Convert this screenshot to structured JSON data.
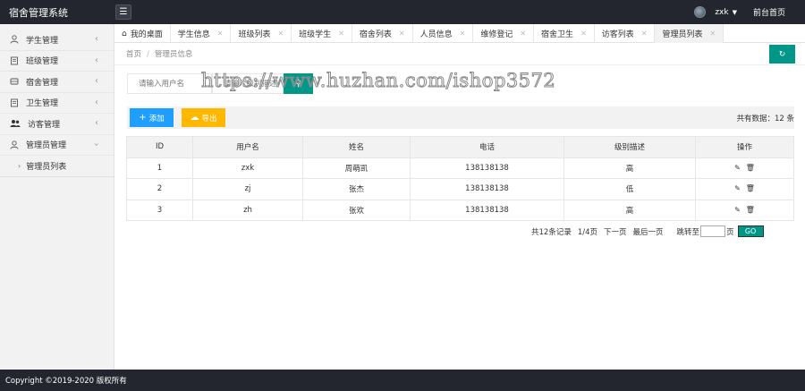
{
  "header": {
    "title": "宿舍管理系统",
    "menu_toggle_icon": "hamburger-icon",
    "user": "zxk",
    "front_link": "前台首页"
  },
  "sidebar": {
    "items": [
      {
        "label": "学生管理",
        "icon": "user-icon"
      },
      {
        "label": "班级管理",
        "icon": "file-icon"
      },
      {
        "label": "宿舍管理",
        "icon": "dorm-icon"
      },
      {
        "label": "卫生管理",
        "icon": "file-icon"
      },
      {
        "label": "访客管理",
        "icon": "users-icon"
      },
      {
        "label": "管理员管理",
        "icon": "admin-icon",
        "expanded": true
      }
    ],
    "sub_items": [
      {
        "label": "管理员列表"
      }
    ]
  },
  "tabs": [
    {
      "label": "我的桌面",
      "closable": false
    },
    {
      "label": "学生信息",
      "closable": true
    },
    {
      "label": "班级列表",
      "closable": true
    },
    {
      "label": "班级学生",
      "closable": true
    },
    {
      "label": "宿舍列表",
      "closable": true
    },
    {
      "label": "人员信息",
      "closable": true
    },
    {
      "label": "维修登记",
      "closable": true
    },
    {
      "label": "宿舍卫生",
      "closable": true
    },
    {
      "label": "访客列表",
      "closable": true
    },
    {
      "label": "管理员列表",
      "closable": true,
      "active": true
    }
  ],
  "breadcrumb": {
    "home": "首页",
    "current": "管理员信息"
  },
  "search": {
    "username_placeholder": "请输入用户名",
    "level_placeholder": "请输入级别描述"
  },
  "toolbar": {
    "add_label": "添加",
    "export_label": "导出",
    "total_label": "共有数据：",
    "total_value": "12 条"
  },
  "table": {
    "columns": [
      "ID",
      "用户名",
      "姓名",
      "电话",
      "级别描述",
      "操作"
    ],
    "rows": [
      {
        "id": "1",
        "username": "zxk",
        "name": "周萌凯",
        "phone": "138138138",
        "level": "高"
      },
      {
        "id": "2",
        "username": "zj",
        "name": "张杰",
        "phone": "138138138",
        "level": "低"
      },
      {
        "id": "3",
        "username": "zh",
        "name": "张欢",
        "phone": "138138138",
        "level": "高"
      }
    ]
  },
  "pager": {
    "records": "共12条记录",
    "page": "1/4页",
    "next": "下一页",
    "last": "最后一页",
    "goto": "跳转至",
    "unit": "页",
    "go": "GO"
  },
  "watermark": "https://www.huzhan.com/ishop3572",
  "footer": {
    "copyright": "Copyright ©2019-2020 版权所有"
  },
  "colors": {
    "header_bg": "#23262e",
    "accent": "#009688",
    "add_blue": "#1e9fff",
    "export_yellow": "#ffb800"
  }
}
